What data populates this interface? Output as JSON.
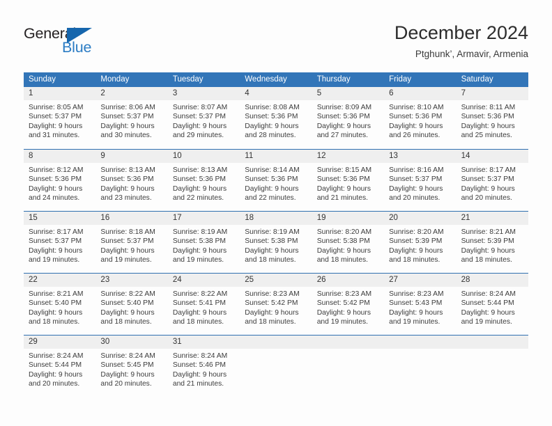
{
  "brand": {
    "name_part1": "General",
    "name_part2": "Blue",
    "triangle_icon": "blue-triangle-icon",
    "accent_color": "#2b7cc4",
    "triangle_color": "#1666ad"
  },
  "header": {
    "title": "December 2024",
    "subtitle": "Ptghunk’, Armavir, Armenia"
  },
  "theme": {
    "header_blue": "#3275b8",
    "row_separator": "#2f6fb0",
    "day_band": "#efefef",
    "text": "#3c3c3c"
  },
  "calendar": {
    "weekdays": [
      "Sunday",
      "Monday",
      "Tuesday",
      "Wednesday",
      "Thursday",
      "Friday",
      "Saturday"
    ],
    "weeks": [
      [
        {
          "day": "1",
          "lines": [
            "Sunrise: 8:05 AM",
            "Sunset: 5:37 PM",
            "Daylight: 9 hours",
            "and 31 minutes."
          ]
        },
        {
          "day": "2",
          "lines": [
            "Sunrise: 8:06 AM",
            "Sunset: 5:37 PM",
            "Daylight: 9 hours",
            "and 30 minutes."
          ]
        },
        {
          "day": "3",
          "lines": [
            "Sunrise: 8:07 AM",
            "Sunset: 5:37 PM",
            "Daylight: 9 hours",
            "and 29 minutes."
          ]
        },
        {
          "day": "4",
          "lines": [
            "Sunrise: 8:08 AM",
            "Sunset: 5:36 PM",
            "Daylight: 9 hours",
            "and 28 minutes."
          ]
        },
        {
          "day": "5",
          "lines": [
            "Sunrise: 8:09 AM",
            "Sunset: 5:36 PM",
            "Daylight: 9 hours",
            "and 27 minutes."
          ]
        },
        {
          "day": "6",
          "lines": [
            "Sunrise: 8:10 AM",
            "Sunset: 5:36 PM",
            "Daylight: 9 hours",
            "and 26 minutes."
          ]
        },
        {
          "day": "7",
          "lines": [
            "Sunrise: 8:11 AM",
            "Sunset: 5:36 PM",
            "Daylight: 9 hours",
            "and 25 minutes."
          ]
        }
      ],
      [
        {
          "day": "8",
          "lines": [
            "Sunrise: 8:12 AM",
            "Sunset: 5:36 PM",
            "Daylight: 9 hours",
            "and 24 minutes."
          ]
        },
        {
          "day": "9",
          "lines": [
            "Sunrise: 8:13 AM",
            "Sunset: 5:36 PM",
            "Daylight: 9 hours",
            "and 23 minutes."
          ]
        },
        {
          "day": "10",
          "lines": [
            "Sunrise: 8:13 AM",
            "Sunset: 5:36 PM",
            "Daylight: 9 hours",
            "and 22 minutes."
          ]
        },
        {
          "day": "11",
          "lines": [
            "Sunrise: 8:14 AM",
            "Sunset: 5:36 PM",
            "Daylight: 9 hours",
            "and 22 minutes."
          ]
        },
        {
          "day": "12",
          "lines": [
            "Sunrise: 8:15 AM",
            "Sunset: 5:36 PM",
            "Daylight: 9 hours",
            "and 21 minutes."
          ]
        },
        {
          "day": "13",
          "lines": [
            "Sunrise: 8:16 AM",
            "Sunset: 5:37 PM",
            "Daylight: 9 hours",
            "and 20 minutes."
          ]
        },
        {
          "day": "14",
          "lines": [
            "Sunrise: 8:17 AM",
            "Sunset: 5:37 PM",
            "Daylight: 9 hours",
            "and 20 minutes."
          ]
        }
      ],
      [
        {
          "day": "15",
          "lines": [
            "Sunrise: 8:17 AM",
            "Sunset: 5:37 PM",
            "Daylight: 9 hours",
            "and 19 minutes."
          ]
        },
        {
          "day": "16",
          "lines": [
            "Sunrise: 8:18 AM",
            "Sunset: 5:37 PM",
            "Daylight: 9 hours",
            "and 19 minutes."
          ]
        },
        {
          "day": "17",
          "lines": [
            "Sunrise: 8:19 AM",
            "Sunset: 5:38 PM",
            "Daylight: 9 hours",
            "and 19 minutes."
          ]
        },
        {
          "day": "18",
          "lines": [
            "Sunrise: 8:19 AM",
            "Sunset: 5:38 PM",
            "Daylight: 9 hours",
            "and 18 minutes."
          ]
        },
        {
          "day": "19",
          "lines": [
            "Sunrise: 8:20 AM",
            "Sunset: 5:38 PM",
            "Daylight: 9 hours",
            "and 18 minutes."
          ]
        },
        {
          "day": "20",
          "lines": [
            "Sunrise: 8:20 AM",
            "Sunset: 5:39 PM",
            "Daylight: 9 hours",
            "and 18 minutes."
          ]
        },
        {
          "day": "21",
          "lines": [
            "Sunrise: 8:21 AM",
            "Sunset: 5:39 PM",
            "Daylight: 9 hours",
            "and 18 minutes."
          ]
        }
      ],
      [
        {
          "day": "22",
          "lines": [
            "Sunrise: 8:21 AM",
            "Sunset: 5:40 PM",
            "Daylight: 9 hours",
            "and 18 minutes."
          ]
        },
        {
          "day": "23",
          "lines": [
            "Sunrise: 8:22 AM",
            "Sunset: 5:40 PM",
            "Daylight: 9 hours",
            "and 18 minutes."
          ]
        },
        {
          "day": "24",
          "lines": [
            "Sunrise: 8:22 AM",
            "Sunset: 5:41 PM",
            "Daylight: 9 hours",
            "and 18 minutes."
          ]
        },
        {
          "day": "25",
          "lines": [
            "Sunrise: 8:23 AM",
            "Sunset: 5:42 PM",
            "Daylight: 9 hours",
            "and 18 minutes."
          ]
        },
        {
          "day": "26",
          "lines": [
            "Sunrise: 8:23 AM",
            "Sunset: 5:42 PM",
            "Daylight: 9 hours",
            "and 19 minutes."
          ]
        },
        {
          "day": "27",
          "lines": [
            "Sunrise: 8:23 AM",
            "Sunset: 5:43 PM",
            "Daylight: 9 hours",
            "and 19 minutes."
          ]
        },
        {
          "day": "28",
          "lines": [
            "Sunrise: 8:24 AM",
            "Sunset: 5:44 PM",
            "Daylight: 9 hours",
            "and 19 minutes."
          ]
        }
      ],
      [
        {
          "day": "29",
          "lines": [
            "Sunrise: 8:24 AM",
            "Sunset: 5:44 PM",
            "Daylight: 9 hours",
            "and 20 minutes."
          ]
        },
        {
          "day": "30",
          "lines": [
            "Sunrise: 8:24 AM",
            "Sunset: 5:45 PM",
            "Daylight: 9 hours",
            "and 20 minutes."
          ]
        },
        {
          "day": "31",
          "lines": [
            "Sunrise: 8:24 AM",
            "Sunset: 5:46 PM",
            "Daylight: 9 hours",
            "and 21 minutes."
          ]
        },
        {
          "day": "",
          "lines": []
        },
        {
          "day": "",
          "lines": []
        },
        {
          "day": "",
          "lines": []
        },
        {
          "day": "",
          "lines": []
        }
      ]
    ]
  }
}
